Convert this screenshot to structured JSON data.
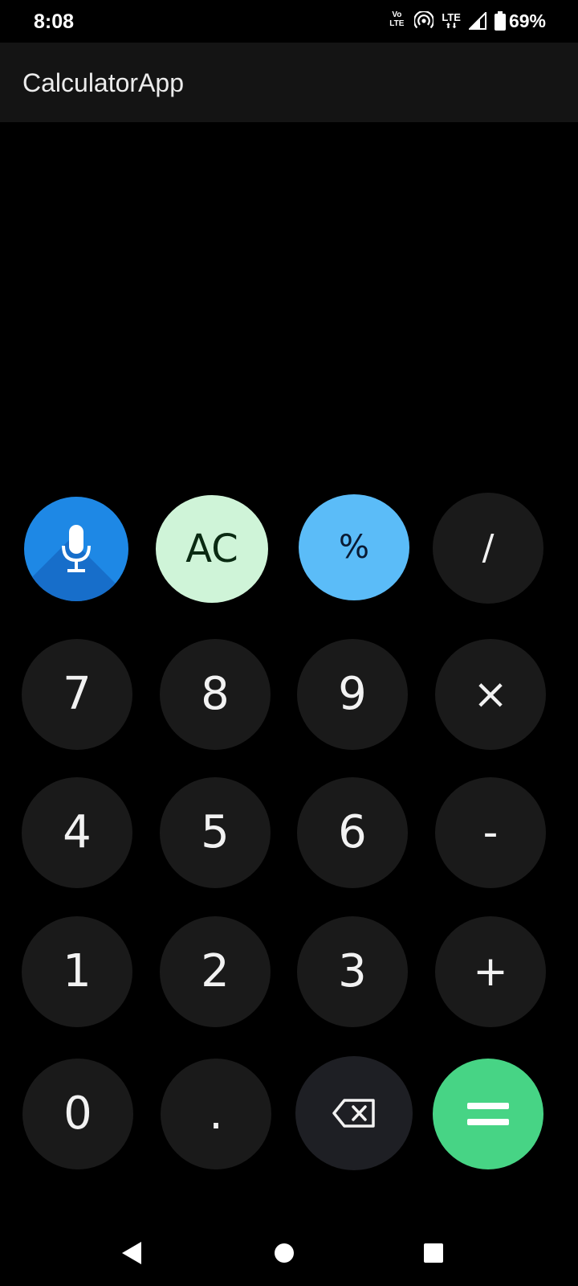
{
  "status_bar": {
    "time": "8:08",
    "volte_line1": "Vo",
    "volte_line2": "LTE",
    "network": "LTE",
    "battery_percent": "69%",
    "icons": [
      "volte-icon",
      "hotspot-icon",
      "lte-data-icon",
      "signal-icon",
      "battery-icon"
    ]
  },
  "app_bar": {
    "title": "CalculatorApp"
  },
  "display": {
    "expression": "",
    "result": ""
  },
  "keypad": {
    "rows": [
      [
        "mic",
        "AC",
        "%",
        "/"
      ],
      [
        "7",
        "8",
        "9",
        "×"
      ],
      [
        "4",
        "5",
        "6",
        "-"
      ],
      [
        "1",
        "2",
        "3",
        "+"
      ],
      [
        "0",
        ".",
        "backspace",
        "="
      ]
    ],
    "ac": "AC",
    "percent": "%",
    "divide": "/",
    "multiply": "×",
    "minus": "-",
    "plus": "+",
    "dot": ".",
    "equals": "=",
    "d0": "0",
    "d1": "1",
    "d2": "2",
    "d3": "3",
    "d4": "4",
    "d5": "5",
    "d6": "6",
    "d7": "7",
    "d8": "8",
    "d9": "9"
  },
  "colors": {
    "background": "#000000",
    "app_bar": "#141414",
    "key": "#1a1a1a",
    "mic": "#1e88e5",
    "ac": "#cff4d8",
    "percent": "#5bbcf8",
    "equals": "#47d485",
    "backspace": "#1e1f24"
  },
  "nav_bar": {
    "icons": [
      "back-icon",
      "home-icon",
      "recents-icon"
    ]
  }
}
